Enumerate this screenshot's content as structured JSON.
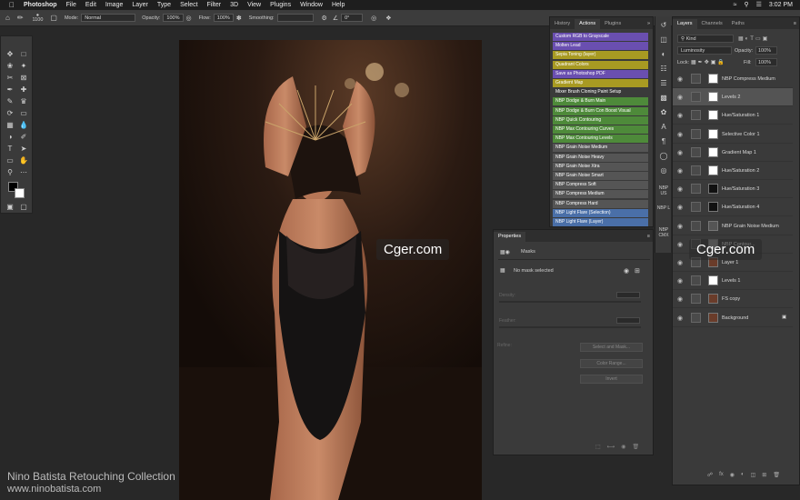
{
  "menubar": {
    "app_name": "Photoshop",
    "items": [
      "File",
      "Edit",
      "Image",
      "Layer",
      "Type",
      "Select",
      "Filter",
      "3D",
      "View",
      "Plugins",
      "Window",
      "Help"
    ],
    "clock": "3:02 PM"
  },
  "options": {
    "brush_size": "1100",
    "mode_label": "Mode:",
    "mode_value": "Normal",
    "opacity_label": "Opacity:",
    "opacity_value": "100%",
    "flow_label": "Flow:",
    "flow_value": "100%",
    "smoothing_label": "Smoothing:",
    "angle_value": "0°"
  },
  "actions_panel": {
    "tabs": [
      "History",
      "Actions",
      "Plugins"
    ],
    "active_tab": "Actions",
    "items": [
      {
        "label": "Custom RGB to Grayscale",
        "color": "#6a4fb0"
      },
      {
        "label": "Molten Lead",
        "color": "#6a4fb0"
      },
      {
        "label": "Sepia Toning (layer)",
        "color": "#a89a22"
      },
      {
        "label": "Quadrant Colors",
        "color": "#a89a22"
      },
      {
        "label": "Save as Photoshop PDF",
        "color": "#6a4fb0"
      },
      {
        "label": "Gradient Map",
        "color": "#a89a22"
      },
      {
        "label": "Mixer Brush Cloning Paint Setup",
        "color": "#3a3a3a"
      },
      {
        "label": "NBP Dodge & Burn Main",
        "color": "#4e8a3a"
      },
      {
        "label": "NBP Dodge & Burn Con Boost Visual",
        "color": "#4e8a3a"
      },
      {
        "label": "NBP Quick Contouring",
        "color": "#4e8a3a"
      },
      {
        "label": "NBP Max Contouring Curves",
        "color": "#4e8a3a"
      },
      {
        "label": "NBP Max Contouring Levels",
        "color": "#4e8a3a"
      },
      {
        "label": "NBP Grain Noise Medium",
        "color": "#555555"
      },
      {
        "label": "NBP Grain Noise Heavy",
        "color": "#555555"
      },
      {
        "label": "NBP Grain Noise Xtra",
        "color": "#555555"
      },
      {
        "label": "NBP Grain Noise Smart",
        "color": "#555555"
      },
      {
        "label": "NBP Compress Soft",
        "color": "#555555"
      },
      {
        "label": "NBP Compress Medium",
        "color": "#555555"
      },
      {
        "label": "NBP Compress Hard",
        "color": "#555555"
      },
      {
        "label": "NBP Light Flare (Selection)",
        "color": "#4a6fa8"
      },
      {
        "label": "NBP Light Flare (Layer)",
        "color": "#4a6fa8"
      }
    ]
  },
  "side_strip": [
    "NBP US",
    "NBP L",
    "NBP CMX"
  ],
  "properties": {
    "title": "Properties",
    "masks_label": "Masks",
    "no_mask": "No mask selected",
    "density_label": "Density:",
    "feather_label": "Feather:",
    "refine_label": "Refine:",
    "select_mask_btn": "Select and Mask...",
    "color_range_btn": "Color Range...",
    "invert_btn": "Invert"
  },
  "layers_panel": {
    "tabs": [
      "Layers",
      "Channels",
      "Paths"
    ],
    "kind_label": "Kind",
    "blend_mode": "Luminosity",
    "opacity_label": "Opacity:",
    "opacity_value": "100%",
    "lock_label": "Lock:",
    "fill_label": "Fill:",
    "fill_value": "100%",
    "layers": [
      {
        "name": "NBP Compress Medium"
      },
      {
        "name": "Levels 2"
      },
      {
        "name": "Hue/Saturation 1"
      },
      {
        "name": "Selective Color 1"
      },
      {
        "name": "Gradient Map 1"
      },
      {
        "name": "Hue/Saturation 2"
      },
      {
        "name": "Hue/Saturation 3"
      },
      {
        "name": "Hue/Saturation 4"
      },
      {
        "name": "NBP Grain Noise Medium"
      },
      {
        "name": "NBP Cgntour..."
      },
      {
        "name": "Layer 1"
      },
      {
        "name": "Levels 1"
      },
      {
        "name": "FS copy"
      },
      {
        "name": "Background"
      }
    ]
  },
  "watermarks": {
    "site": "Cger.com",
    "collection_title": "Nino Batista Retouching Collection",
    "collection_url": "www.ninobatista.com"
  }
}
